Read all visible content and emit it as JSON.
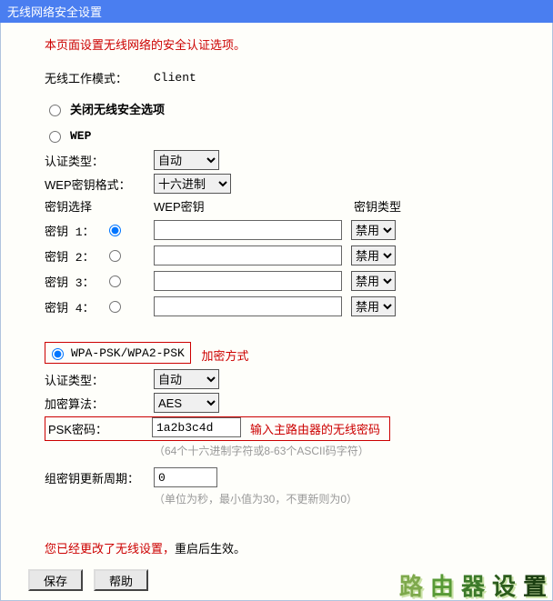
{
  "title": "无线网络安全设置",
  "description": "本页面设置无线网络的安全认证选项。",
  "mode": {
    "label": "无线工作模式：",
    "value": "Client"
  },
  "security_options": {
    "off_label": "关闭无线安全选项",
    "wep_label": "WEP",
    "wpa_label": "WPA-PSK/WPA2-PSK"
  },
  "wep": {
    "auth_label": "认证类型：",
    "auth_value": "自动",
    "fmt_label": "WEP密钥格式：",
    "fmt_value": "十六进制",
    "header": {
      "select": "密钥选择",
      "key": "WEP密钥",
      "type": "密钥类型"
    },
    "keys": [
      {
        "label": "密钥 1：",
        "value": "",
        "type": "禁用"
      },
      {
        "label": "密钥 2：",
        "value": "",
        "type": "禁用"
      },
      {
        "label": "密钥 3：",
        "value": "",
        "type": "禁用"
      },
      {
        "label": "密钥 4：",
        "value": "",
        "type": "禁用"
      }
    ]
  },
  "wpa": {
    "annot_method": "加密方式",
    "auth_label": "认证类型：",
    "auth_value": "自动",
    "algo_label": "加密算法：",
    "algo_value": "AES",
    "psk_label": "PSK密码：",
    "psk_value": "1a2b3c4d",
    "psk_annot": "输入主路由器的无线密码",
    "psk_hint": "（64个十六进制字符或8-63个ASCII码字符）",
    "rekey_label": "组密钥更新周期：",
    "rekey_value": "0",
    "rekey_hint": "（单位为秒，最小值为30，不更新则为0）"
  },
  "warning": {
    "p1": "您已经更改了无线设置，",
    "p2": "重启后生效。"
  },
  "buttons": {
    "save": "保存",
    "help": "帮助"
  },
  "watermark": [
    "路",
    "由",
    "器",
    "设",
    "置"
  ]
}
